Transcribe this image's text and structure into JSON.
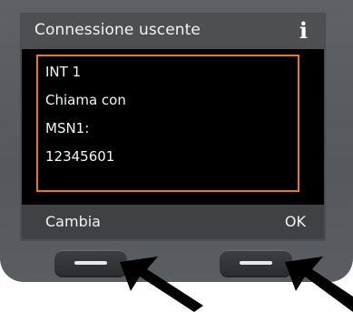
{
  "screen": {
    "title": "Connessione uscente",
    "info_glyph": "i",
    "message_lines": [
      "INT 1",
      "Chiama con",
      "MSN1:",
      "12345601"
    ]
  },
  "softkeys": {
    "left_label": "Cambia",
    "right_label": "OK"
  },
  "icons": {
    "info": "info-icon",
    "arrows": "pointing-arrow-icon"
  },
  "colors": {
    "highlight_border": "#e07a2a",
    "title_bar": "#4d4f53",
    "softkey_bar": "#3f4145",
    "phone_body": "#5e6166"
  }
}
